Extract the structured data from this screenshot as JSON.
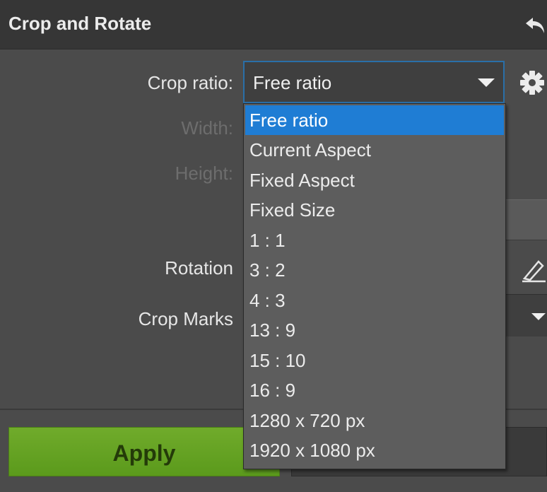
{
  "header": {
    "title": "Crop and Rotate",
    "undo_icon": "undo-icon"
  },
  "form": {
    "crop_ratio_label": "Crop ratio:",
    "crop_ratio_value": "Free ratio",
    "width_label": "Width:",
    "height_label": "Height:",
    "rotation_label": "Rotation",
    "crop_marks_label": "Crop Marks",
    "settings_icon": "gear-icon",
    "straighten_icon": "ruler-icon"
  },
  "dropdown": {
    "items": [
      "Free ratio",
      "Current Aspect",
      "Fixed Aspect",
      "Fixed Size",
      "1 : 1",
      "3 : 2",
      "4 : 3",
      "13 : 9",
      "15 : 10",
      "16 : 9",
      "1280 x 720 px",
      "1920 x 1080 px"
    ],
    "selected": "Free ratio"
  },
  "buttons": {
    "apply_label": "Apply"
  },
  "colors": {
    "apply_green": "#66a322",
    "selection_blue": "#1f7dd4",
    "select_border": "#2a6fa8",
    "panel_bg": "#4b4b4b",
    "header_bg": "#363636"
  }
}
